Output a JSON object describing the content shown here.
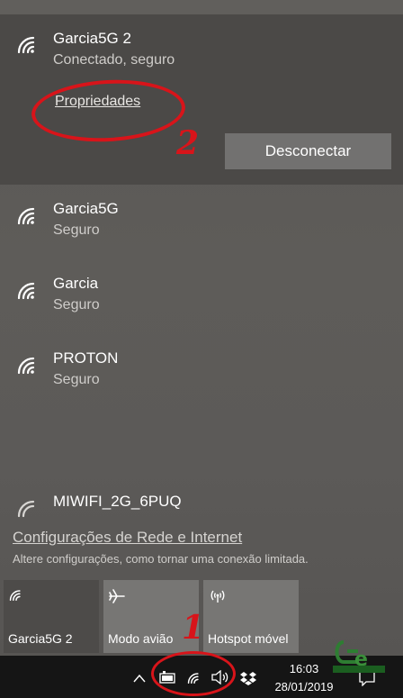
{
  "connected_network": {
    "name": "Garcia5G 2",
    "status": "Conectado, seguro",
    "properties_label": "Propriedades",
    "disconnect_label": "Desconectar"
  },
  "networks": [
    {
      "name": "Garcia5G",
      "status": "Seguro"
    },
    {
      "name": "Garcia",
      "status": "Seguro"
    },
    {
      "name": "PROTON",
      "status": "Seguro"
    },
    {
      "name": "MIWIFI_2G_6PUQ"
    }
  ],
  "settings": {
    "link": "Configurações de Rede e Internet",
    "description": "Altere configurações, como tornar uma conexão limitada."
  },
  "tiles": [
    {
      "label": "Garcia5G 2",
      "icon": "wifi-icon",
      "active": true
    },
    {
      "label": "Modo avião",
      "icon": "airplane-icon",
      "active": false
    },
    {
      "label": "Hotspot móvel",
      "icon": "hotspot-icon",
      "active": false
    }
  ],
  "annotations": {
    "first": "1",
    "second": "2"
  },
  "taskbar": {
    "time": "16:03",
    "date": "28/01/2019",
    "tray_icons": [
      "chevron-up-icon",
      "battery-icon",
      "wifi-icon",
      "volume-icon",
      "dropbox-icon",
      "notification-icon"
    ]
  },
  "colors": {
    "annotation": "#d8141a",
    "active_tile": "#4d4b49",
    "inactive_tile": "#777674",
    "taskbar": "#151515"
  }
}
